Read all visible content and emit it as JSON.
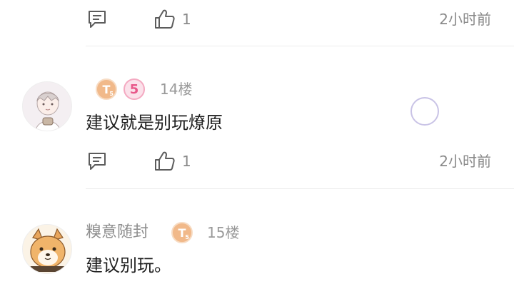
{
  "top_item": {
    "like_count": "1",
    "time": "2小时前",
    "icons": [
      "comment-icon",
      "thumb-up-icon"
    ]
  },
  "comments": [
    {
      "floor": "14楼",
      "username": "",
      "badges": [
        {
          "type": "level-t",
          "text": "T",
          "sub": "5"
        },
        {
          "type": "level-5",
          "text": "5"
        }
      ],
      "text": "建议就是别玩燎原",
      "like_count": "1",
      "time": "2小时前"
    },
    {
      "floor": "15楼",
      "username": "糗意随封",
      "badges": [
        {
          "type": "level-t",
          "text": "T",
          "sub": "5"
        }
      ],
      "text": "建议别玩。"
    }
  ],
  "colors": {
    "text_primary": "#1f1f1f",
    "text_secondary": "#8a8a8a",
    "badge_t": "#f1b98a",
    "badge_5": "#e8588a",
    "loader": "#c9c3e6"
  }
}
